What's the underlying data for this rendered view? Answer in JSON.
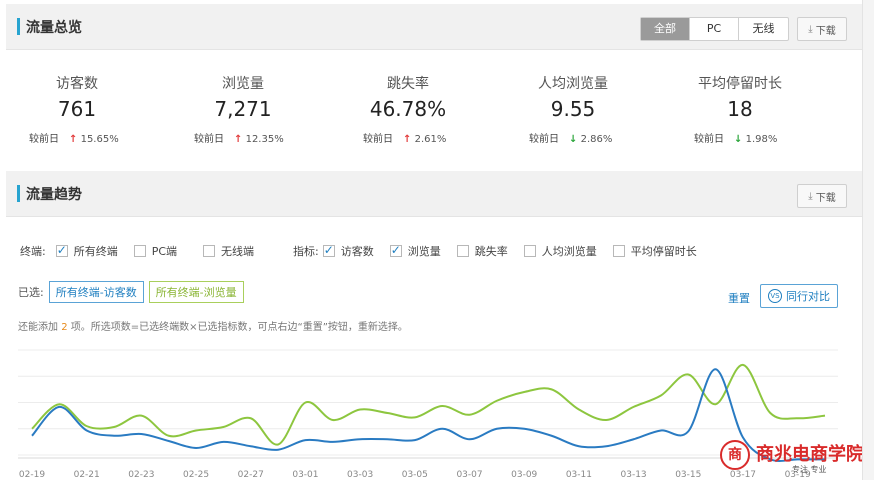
{
  "overview": {
    "title": "流量总览",
    "tabs": [
      "全部",
      "PC",
      "无线"
    ],
    "active_tab": 0,
    "download_label": "下载"
  },
  "stats": [
    {
      "label": "访客数",
      "value": "761",
      "cmp_label": "较前日",
      "dir": "up",
      "change": "15.65%"
    },
    {
      "label": "浏览量",
      "value": "7,271",
      "cmp_label": "较前日",
      "dir": "up",
      "change": "12.35%"
    },
    {
      "label": "跳失率",
      "value": "46.78%",
      "cmp_label": "较前日",
      "dir": "up",
      "change": "2.61%"
    },
    {
      "label": "人均浏览量",
      "value": "9.55",
      "cmp_label": "较前日",
      "dir": "down",
      "change": "2.86%"
    },
    {
      "label": "平均停留时长",
      "value": "18",
      "cmp_label": "较前日",
      "dir": "down",
      "change": "1.98%"
    }
  ],
  "trend": {
    "title": "流量趋势",
    "download_label": "下载",
    "terminal_label": "终端:",
    "terminals": [
      {
        "label": "所有终端",
        "checked": true
      },
      {
        "label": "PC端",
        "checked": false
      },
      {
        "label": "无线端",
        "checked": false
      }
    ],
    "metric_label": "指标:",
    "metrics": [
      {
        "label": "访客数",
        "checked": true
      },
      {
        "label": "浏览量",
        "checked": true
      },
      {
        "label": "跳失率",
        "checked": false
      },
      {
        "label": "人均浏览量",
        "checked": false
      },
      {
        "label": "平均停留时长",
        "checked": false
      }
    ],
    "selected_label": "已选:",
    "selected_tags": [
      "所有终端-访客数",
      "所有终端-浏览量"
    ],
    "reset_label": "重置",
    "peer_label": "同行对比",
    "peer_icon_text": "VS",
    "hint_pre": "还能添加",
    "hint_num": "2",
    "hint_post": "项。所选项数=已选终端数×已选指标数，可点右边“重置”按钮，重新选择。"
  },
  "colors": {
    "accent": "#27a4d0",
    "visitors_line": "#2a7bc2",
    "pageviews_line": "#8dc63f",
    "up": "#e23b3b",
    "down": "#2aa53a"
  },
  "chart_data": {
    "type": "line",
    "x": [
      "02-19",
      "02-20",
      "02-21",
      "02-22",
      "02-23",
      "02-24",
      "02-25",
      "02-26",
      "02-27",
      "02-28",
      "03-01",
      "03-02",
      "03-03",
      "03-04",
      "03-05",
      "03-06",
      "03-07",
      "03-08",
      "03-09",
      "03-10",
      "03-11",
      "03-12",
      "03-13",
      "03-14",
      "03-15",
      "03-16",
      "03-17",
      "03-18",
      "03-19",
      "03-20"
    ],
    "xticks": [
      "02-19",
      "02-21",
      "02-23",
      "02-25",
      "02-27",
      "03-01",
      "03-03",
      "03-05",
      "03-07",
      "03-09",
      "03-11",
      "03-13",
      "03-15",
      "03-17",
      "03-19"
    ],
    "ylim": [
      0,
      120
    ],
    "grid": true,
    "series": [
      {
        "name": "所有终端-访客数",
        "color": "#2a7bc2",
        "values": [
          22,
          55,
          28,
          22,
          24,
          16,
          8,
          15,
          10,
          6,
          17,
          15,
          18,
          18,
          17,
          30,
          18,
          30,
          30,
          22,
          10,
          10,
          18,
          28,
          27,
          98,
          20,
          -5,
          -5,
          -5
        ]
      },
      {
        "name": "所有终端-浏览量",
        "color": "#8dc63f",
        "values": [
          30,
          58,
          33,
          32,
          45,
          22,
          28,
          32,
          42,
          12,
          60,
          40,
          52,
          48,
          43,
          56,
          46,
          62,
          72,
          75,
          52,
          40,
          55,
          68,
          92,
          58,
          103,
          48,
          42,
          45
        ]
      }
    ]
  },
  "brand": {
    "logo_text": "商",
    "name": "商兆电商学院",
    "sub": "专注 专业"
  }
}
